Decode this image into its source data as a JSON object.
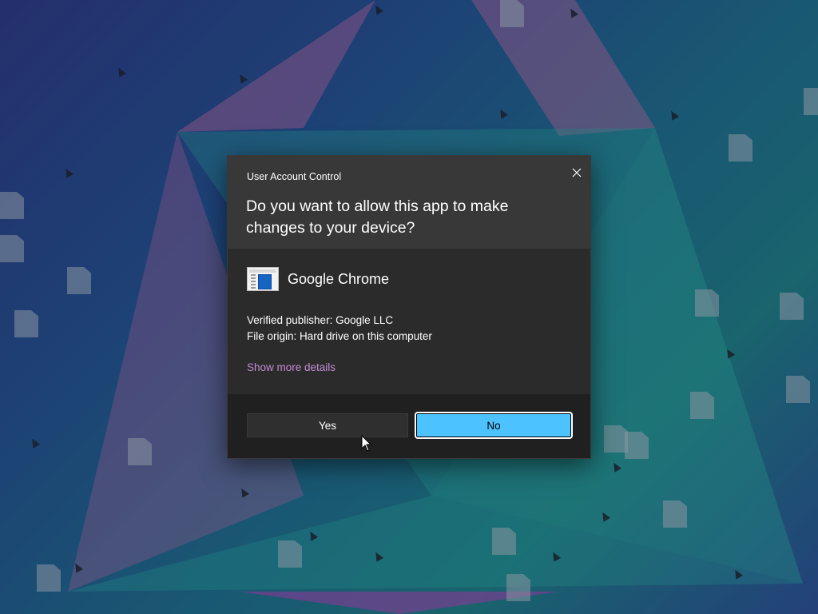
{
  "dialog": {
    "caption": "User Account Control",
    "question": "Do you want to allow this app to make changes to your device?",
    "app_name": "Google Chrome",
    "publisher_line": "Verified publisher: Google LLC",
    "origin_line": "File origin: Hard drive on this computer",
    "details_link": "Show more details",
    "yes_label": "Yes",
    "no_label": "No"
  },
  "colors": {
    "dialog_bg": "#2b2b2b",
    "header_bg": "#383838",
    "footer_bg": "#202020",
    "link": "#c58bd6",
    "primary_button": "#4cc2ff"
  },
  "icons": {
    "close": "close-icon",
    "app": "application-icon",
    "cursor": "mouse-pointer-icon"
  }
}
